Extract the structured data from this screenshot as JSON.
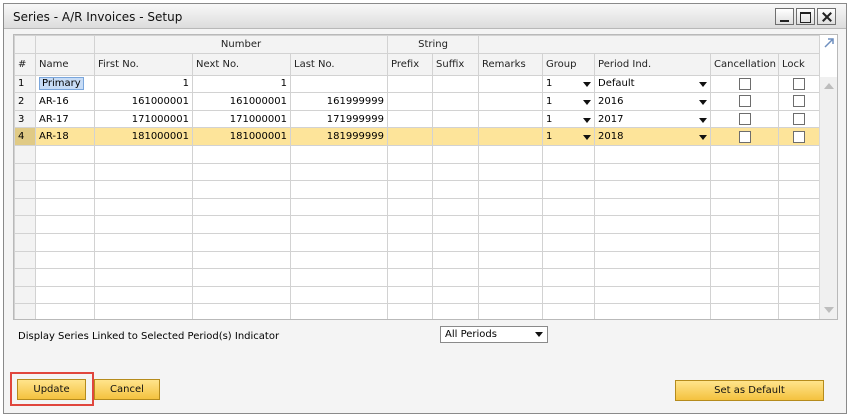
{
  "window": {
    "title": "Series - A/R Invoices - Setup"
  },
  "grid": {
    "group_headers": {
      "number": "Number",
      "string": "String"
    },
    "columns": {
      "row": "#",
      "name": "Name",
      "first_no": "First No.",
      "next_no": "Next No.",
      "last_no": "Last No.",
      "prefix": "Prefix",
      "suffix": "Suffix",
      "remarks": "Remarks",
      "group": "Group",
      "period_ind": "Period Ind.",
      "cancellation": "Cancellation",
      "lock": "Lock"
    },
    "rows": [
      {
        "row": "1",
        "name": "Primary",
        "first_no": "1",
        "next_no": "1",
        "last_no": "",
        "prefix": "",
        "suffix": "",
        "remarks": "",
        "group": "1",
        "period_ind": "Default",
        "cancellation": false,
        "lock": false
      },
      {
        "row": "2",
        "name": "AR-16",
        "first_no": "161000001",
        "next_no": "161000001",
        "last_no": "161999999",
        "prefix": "",
        "suffix": "",
        "remarks": "",
        "group": "1",
        "period_ind": "2016",
        "cancellation": false,
        "lock": false
      },
      {
        "row": "3",
        "name": "AR-17",
        "first_no": "171000001",
        "next_no": "171000001",
        "last_no": "171999999",
        "prefix": "",
        "suffix": "",
        "remarks": "",
        "group": "1",
        "period_ind": "2017",
        "cancellation": false,
        "lock": false
      },
      {
        "row": "4",
        "name": "AR-18",
        "first_no": "181000001",
        "next_no": "181000001",
        "last_no": "181999999",
        "prefix": "",
        "suffix": "",
        "remarks": "",
        "group": "1",
        "period_ind": "2018",
        "cancellation": false,
        "lock": false
      }
    ],
    "selected_row": "4"
  },
  "filter": {
    "label": "Display Series Linked to Selected Period(s) Indicator",
    "selected": "All Periods"
  },
  "buttons": {
    "update": "Update",
    "cancel": "Cancel",
    "set_default": "Set as Default"
  },
  "colors": {
    "button": "#f7c948",
    "selected_row": "#fde49a",
    "highlight_box": "#e0463d"
  }
}
